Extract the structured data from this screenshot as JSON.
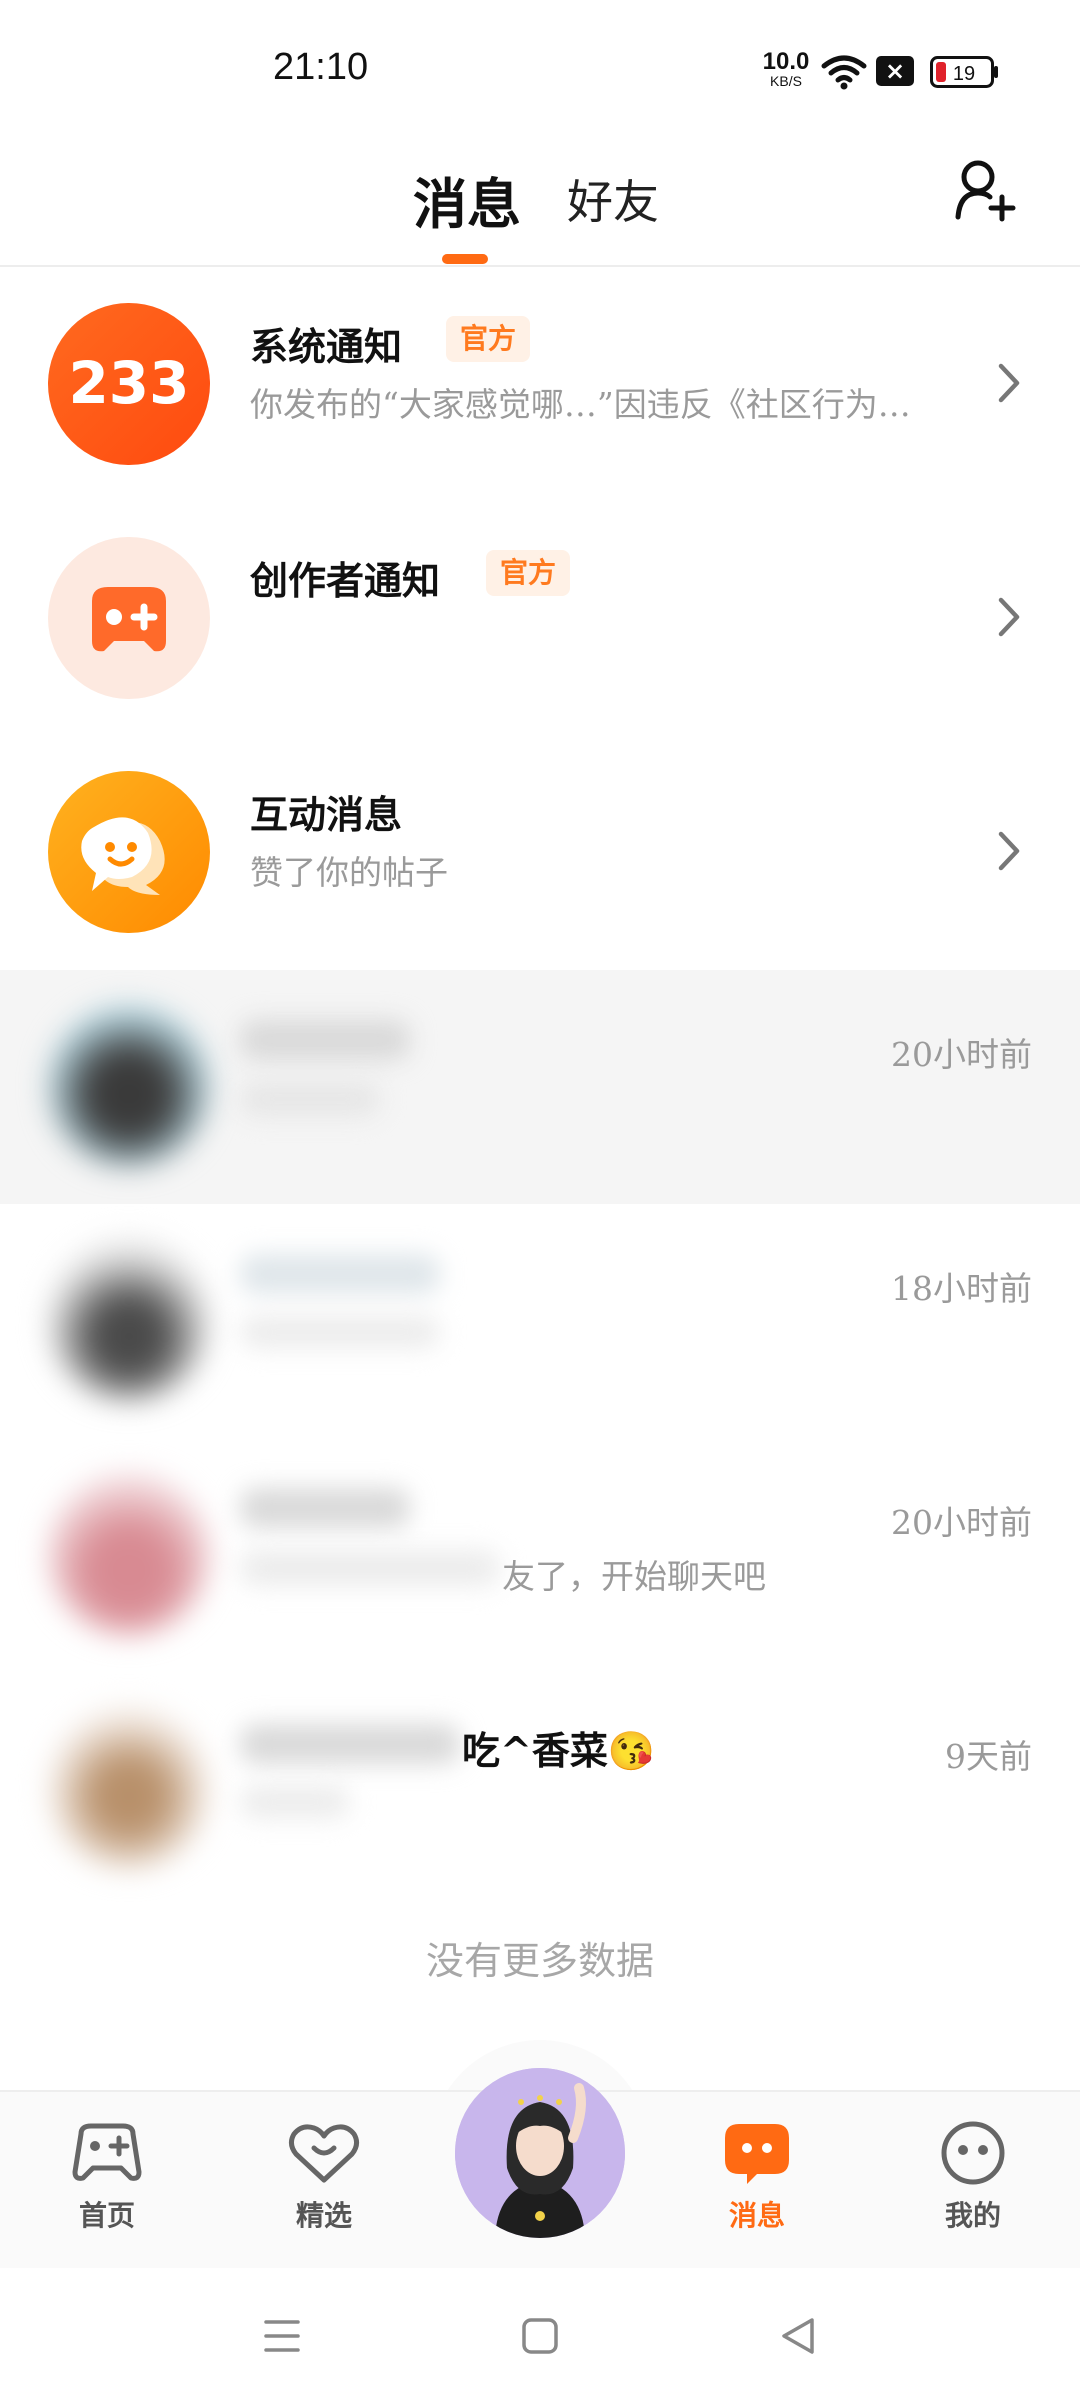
{
  "status_bar": {
    "time": "21:10",
    "net_speed_value": "10.0",
    "net_speed_unit": "KB/S",
    "battery_level": "19"
  },
  "header": {
    "tab_messages": "消息",
    "tab_friends": "好友",
    "add_friend_icon": "add-user-icon",
    "accent_color": "#ff6a13"
  },
  "messages": [
    {
      "title": "系统通知",
      "badge": "官方",
      "subtitle": "你发布的“大家感觉哪…”因违反《社区行为…",
      "avatar_text": "233",
      "avatar_color": "#ff5a1a"
    },
    {
      "title": "创作者通知",
      "badge": "官方",
      "subtitle": "",
      "avatar_icon": "gamepad-icon"
    },
    {
      "title": "互动消息",
      "subtitle": "赞了你的帖子",
      "avatar_icon": "chat-bubble-icon"
    }
  ],
  "chats": [
    {
      "time": "20小时前",
      "preview": ""
    },
    {
      "time": "18小时前",
      "preview": ""
    },
    {
      "time": "20小时前",
      "preview": "友了，开始聊天吧"
    },
    {
      "time": "9天前",
      "name_tail": "吃^香菜😘"
    }
  ],
  "footer_text": "没有更多数据",
  "bottom_nav": {
    "home": "首页",
    "featured": "精选",
    "messages": "消息",
    "mine": "我的"
  }
}
